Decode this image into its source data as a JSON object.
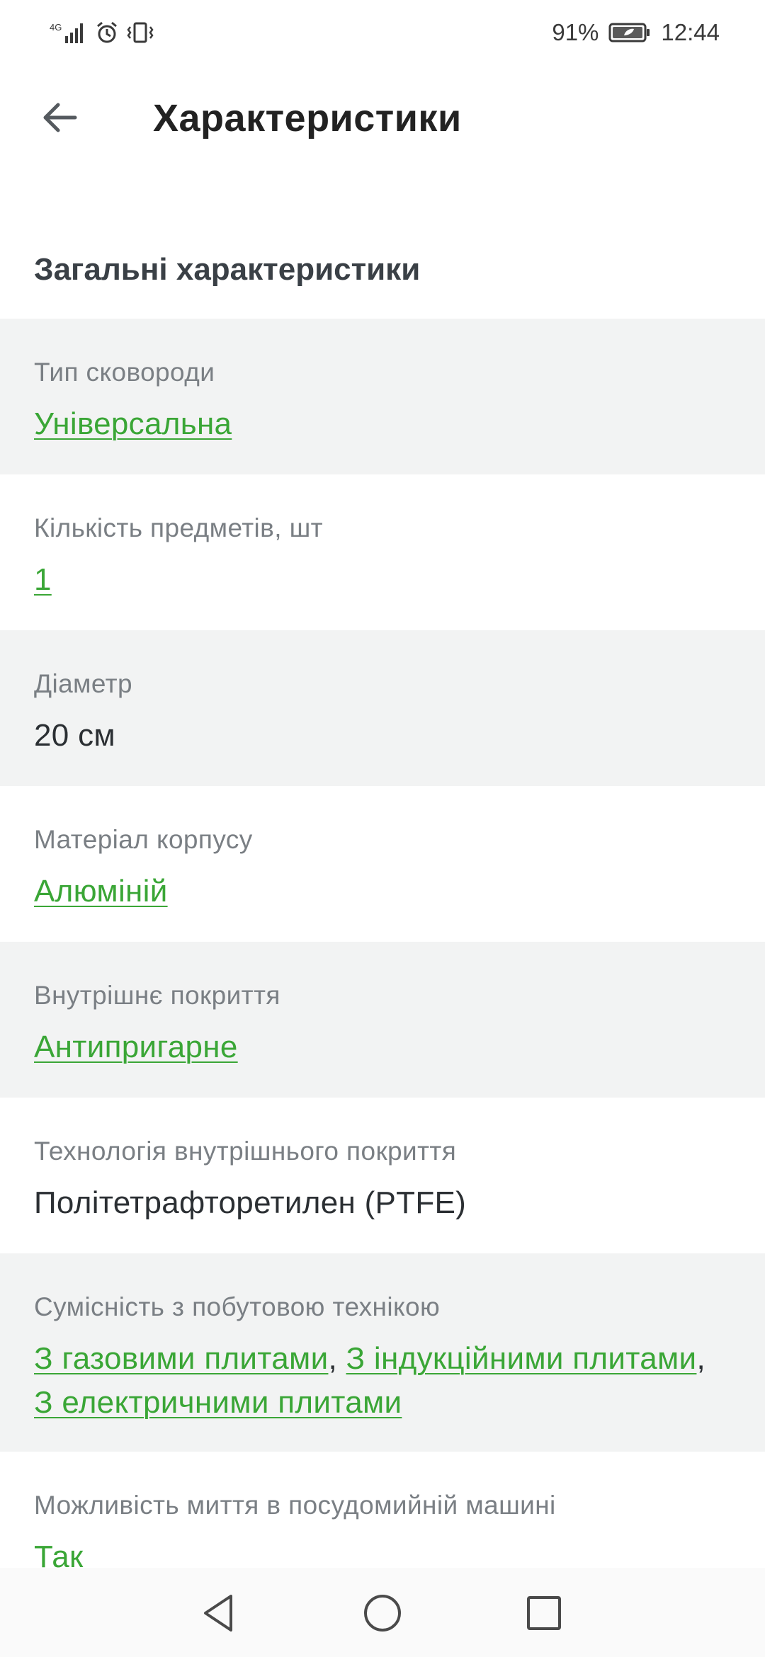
{
  "status_bar": {
    "network": "4G",
    "battery_percent": "91%",
    "time": "12:44"
  },
  "header": {
    "title": "Характеристики",
    "back_icon": "arrow-left-icon"
  },
  "section": {
    "title": "Загальні характеристики"
  },
  "specs": [
    {
      "label": "Тип сковороди",
      "values": [
        "Універсальна"
      ],
      "is_link": true
    },
    {
      "label": "Кількість предметів, шт",
      "values": [
        "1"
      ],
      "is_link": true
    },
    {
      "label": "Діаметр",
      "values": [
        "20 см"
      ],
      "is_link": false
    },
    {
      "label": "Матеріал корпусу",
      "values": [
        "Алюміній"
      ],
      "is_link": true
    },
    {
      "label": "Внутрішнє покриття",
      "values": [
        "Антипригарне"
      ],
      "is_link": true
    },
    {
      "label": "Технологія внутрішнього покриття",
      "values": [
        "Політетрафторетилен (PTFE)"
      ],
      "is_link": false
    },
    {
      "label": "Сумісність з побутовою технікою",
      "values": [
        "З газовими плитами",
        "З індукційними плитами",
        "З електричними плитами"
      ],
      "is_link": true
    },
    {
      "label": "Можливість миття в посудомийній машині",
      "values": [
        "Так"
      ],
      "is_link": true
    }
  ],
  "separator": ",",
  "colors": {
    "link": "#3aa636",
    "row_shade": "#f2f3f3",
    "label": "#7a7f84"
  },
  "nav_bar": {
    "back_icon": "triangle-back-icon",
    "home_icon": "circle-home-icon",
    "recents_icon": "square-recents-icon"
  }
}
